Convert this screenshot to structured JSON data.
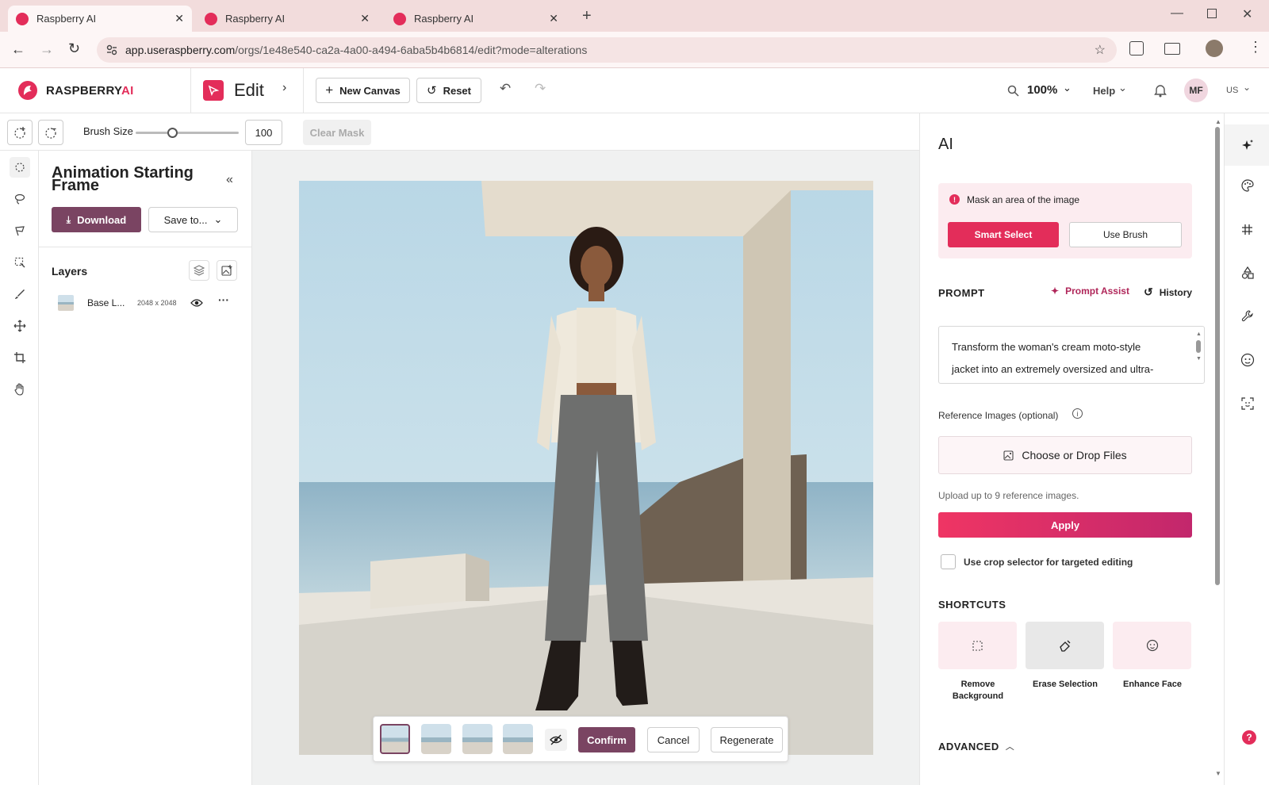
{
  "browser": {
    "tabs": [
      {
        "title": "Raspberry AI",
        "active": true
      },
      {
        "title": "Raspberry AI",
        "active": false
      },
      {
        "title": "Raspberry AI",
        "active": false
      }
    ],
    "url_host": "app.useraspberry.com",
    "url_path": "/orgs/1e48e540-ca2a-4a00-a494-6aba5b4b6814/edit?mode=alterations"
  },
  "header": {
    "brand_main": "RASPBERRY",
    "brand_accent": "AI",
    "mode": "Edit",
    "new_canvas": "New Canvas",
    "reset": "Reset",
    "zoom": "100%",
    "help": "Help",
    "avatar": "MF",
    "locale": "US"
  },
  "toolbar": {
    "brush_label": "Brush Size",
    "brush_value": "100",
    "brush_fraction": 0.35,
    "clear_mask": "Clear Mask"
  },
  "left_panel": {
    "title": "Animation Starting Frame",
    "download": "Download",
    "save_to": "Save to...",
    "layers_title": "Layers",
    "layer": {
      "name": "Base L...",
      "size": "2048 x 2048"
    }
  },
  "canvas_bar": {
    "confirm": "Confirm",
    "cancel": "Cancel",
    "regenerate": "Regenerate",
    "variants": 4
  },
  "ai_panel": {
    "title": "AI",
    "mask_notice": "Mask an area of the image",
    "smart_select": "Smart Select",
    "use_brush": "Use Brush",
    "prompt_label": "PROMPT",
    "prompt_assist": "Prompt Assist",
    "history": "History",
    "prompt_line1": "Transform the woman's cream moto-style",
    "prompt_line2": "jacket into an extremely oversized and ultra-",
    "reference_label": "Reference Images (optional)",
    "choose_files": "Choose or Drop Files",
    "upload_hint": "Upload up to 9 reference images.",
    "apply": "Apply",
    "crop_selector": "Use crop selector for targeted editing",
    "shortcuts_label": "SHORTCUTS",
    "shortcuts": [
      {
        "line1": "Remove",
        "line2": "Background"
      },
      {
        "line1": "Erase Selection",
        "line2": ""
      },
      {
        "line1": "Enhance Face",
        "line2": ""
      }
    ],
    "advanced": "ADVANCED"
  },
  "colors": {
    "brand": "#e32d5a",
    "primary_dark": "#7a4462",
    "accent_pink": "#b0275a",
    "panel_pink": "#fcecf0"
  }
}
